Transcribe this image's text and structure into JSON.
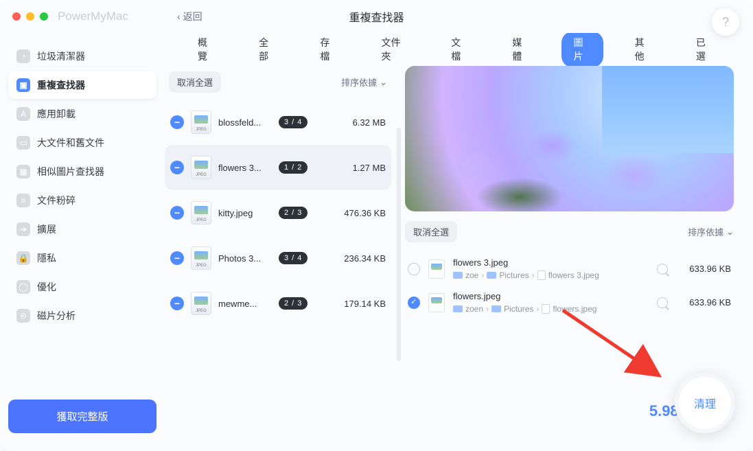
{
  "app_name": "PowerMyMac",
  "back_label": "返回",
  "title": "重複查找器",
  "help_label": "?",
  "sidebar": {
    "items": [
      {
        "label": "垃圾清潔器"
      },
      {
        "label": "重複查找器"
      },
      {
        "label": "應用卸載"
      },
      {
        "label": "大文件和舊文件"
      },
      {
        "label": "相似圖片查找器"
      },
      {
        "label": "文件粉碎"
      },
      {
        "label": "擴展"
      },
      {
        "label": "隱私"
      },
      {
        "label": "優化"
      },
      {
        "label": "磁片分析"
      }
    ],
    "cta": "獲取完整版"
  },
  "tabs": [
    "概覽",
    "全部",
    "存檔",
    "文件夾",
    "文檔",
    "媒體",
    "圖片",
    "其他",
    "已選"
  ],
  "active_tab": "圖片",
  "list": {
    "deselect": "取消全選",
    "sort": "排序依據",
    "rows": [
      {
        "name": "blossfeld...",
        "badge": "3 / 4",
        "size": "6.32 MB"
      },
      {
        "name": "flowers 3...",
        "badge": "1 / 2",
        "size": "1.27 MB"
      },
      {
        "name": "kitty.jpeg",
        "badge": "2 / 3",
        "size": "476.36 KB"
      },
      {
        "name": "Photos 3...",
        "badge": "3 / 4",
        "size": "236.34 KB"
      },
      {
        "name": "mewme...",
        "badge": "2 / 3",
        "size": "179.14 KB"
      }
    ]
  },
  "dups": {
    "deselect": "取消全選",
    "sort": "排序依據",
    "rows": [
      {
        "checked": false,
        "name": "flowers 3.jpeg",
        "path": [
          "zoe",
          "Pictures",
          "flowers 3.jpeg"
        ],
        "size": "633.96 KB"
      },
      {
        "checked": true,
        "name": "flowers.jpeg",
        "path": [
          "zoen",
          "Pictures",
          "flowers.jpeg"
        ],
        "size": "633.96 KB"
      }
    ]
  },
  "total_size": "5.98 MB",
  "clean_label": "清理",
  "crumb_sep": "›"
}
